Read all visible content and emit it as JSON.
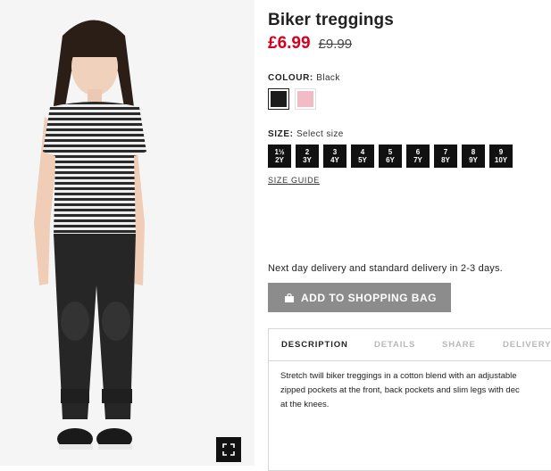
{
  "product": {
    "title": "Biker treggings",
    "price_now": "£6.99",
    "price_old": "£9.99",
    "image_alt_icon": "fullscreen-icon"
  },
  "colour": {
    "label": "COLOUR:",
    "value": "Black",
    "swatches": [
      {
        "name": "Black",
        "color": "#1c1c1c",
        "selected": true
      },
      {
        "name": "Pink",
        "color": "#f2bcc6",
        "selected": false
      }
    ]
  },
  "size": {
    "label": "SIZE:",
    "value": "Select size",
    "options": [
      {
        "top": "1½",
        "bottom": "2Y"
      },
      {
        "top": "2",
        "bottom": "3Y"
      },
      {
        "top": "3",
        "bottom": "4Y"
      },
      {
        "top": "4",
        "bottom": "5Y"
      },
      {
        "top": "5",
        "bottom": "6Y"
      },
      {
        "top": "6",
        "bottom": "7Y"
      },
      {
        "top": "7",
        "bottom": "8Y"
      },
      {
        "top": "8",
        "bottom": "9Y"
      },
      {
        "top": "9",
        "bottom": "10Y"
      }
    ],
    "guide_label": "SIZE GUIDE"
  },
  "delivery_text": "Next day delivery and standard delivery in 2-3 days.",
  "add_to_bag_label": "ADD TO SHOPPING BAG",
  "tabs": {
    "description": "DESCRIPTION",
    "details": "DETAILS",
    "share": "SHARE",
    "delivery": "DELIVERY"
  },
  "description_text": "Stretch twill biker treggings in a cotton blend with an adjustable\nzipped pockets at the front, back pockets and slim legs with dec\nat the knees.",
  "colors": {
    "price_accent": "#d6001c",
    "button_grey": "#8c8c8c",
    "size_button": "#111111"
  }
}
